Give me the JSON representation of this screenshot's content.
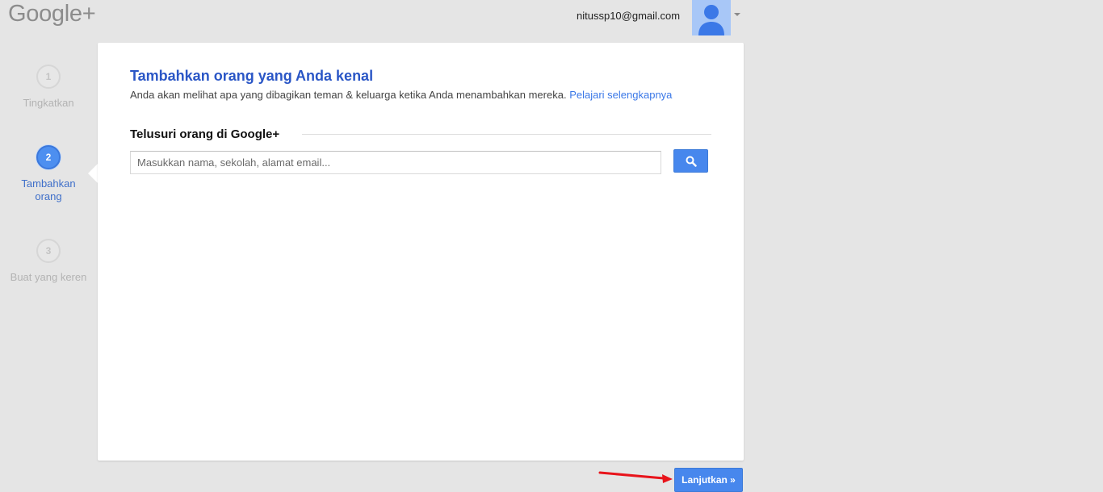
{
  "header": {
    "logo_text": "Google+",
    "account_email": "nitussp10@gmail.com",
    "avatar_icon": "person-avatar-icon",
    "menu_icon": "caret-down-icon"
  },
  "steps": [
    {
      "number": "1",
      "label": "Tingkatkan",
      "state": "inactive"
    },
    {
      "number": "2",
      "label": "Tambahkan orang",
      "state": "active"
    },
    {
      "number": "3",
      "label": "Buat yang keren",
      "state": "inactive"
    }
  ],
  "card": {
    "title": "Tambahkan orang yang Anda kenal",
    "description": "Anda akan melihat apa yang dibagikan teman & keluarga ketika Anda menambahkan mereka.",
    "learn_more": "Pelajari selengkapnya",
    "section_title": "Telusuri orang di Google+",
    "search_placeholder": "Masukkan nama, sekolah, alamat email...",
    "search_value": "",
    "search_icon": "search-icon"
  },
  "footer": {
    "continue_label": "Lanjutkan »",
    "annotation_icon": "red-arrow-annotation"
  },
  "colors": {
    "background": "#e5e5e5",
    "accent_blue": "#4787ed",
    "title_blue": "#2a56c6",
    "link_blue": "#3b78e7",
    "annotation_red": "#e8141b"
  }
}
